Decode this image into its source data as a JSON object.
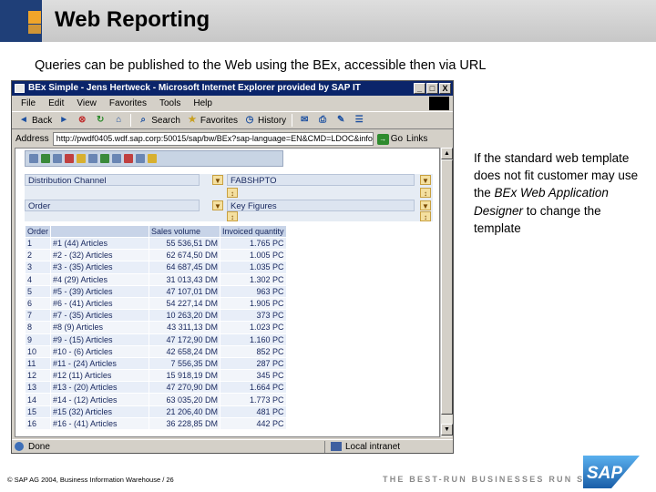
{
  "slide": {
    "title": "Web Reporting",
    "subtitle": "Queries can be published to the Web using the BEx, accessible then via URL",
    "side_text_1": "If the standard web template does not fit customer may use the ",
    "side_text_italic": "BEx Web Application Designer",
    "side_text_2": " to change the template",
    "footer_copyright": "© SAP AG 2004, Business Information Warehouse / 26",
    "footer_tagline": "THE BEST-RUN BUSINESSES RUN SAP",
    "logo_text": "SAP",
    "colors": {
      "header_accent": "#1f3f78",
      "orange": "#f0a52a",
      "sap_blue": "#1f6fc0"
    }
  },
  "browser": {
    "title": "BEx Simple - Jens Hertweck - Microsoft Internet Explorer provided by SAP IT",
    "window_buttons": [
      "_",
      "□",
      "X"
    ],
    "menu": [
      "File",
      "Edit",
      "View",
      "Favorites",
      "Tools",
      "Help"
    ],
    "toolbar": {
      "back": "Back",
      "search": "Search",
      "favorites": "Favorites",
      "history": "History"
    },
    "address_label": "Address",
    "address_value": "http://pwdf0405.wdf.sap.corp:50015/sap/bw/BEx?sap-language=EN&CMD=LDOC&infocube",
    "go_label": "Go",
    "links_label": "Links",
    "status_left": "Done",
    "status_right": "Local intranet"
  },
  "bex": {
    "nav": {
      "distribution_channel": "Distribution Channel",
      "fabshpto": "FABSHPTO",
      "order": "Order",
      "key_figures": "Key Figures"
    },
    "table": {
      "headers": [
        "Order",
        "",
        "Sales volume",
        "Invoiced quantity"
      ],
      "rows": [
        [
          "1",
          "#1  (44) Articles",
          "55 536,51 DM",
          "1.765 PC"
        ],
        [
          "2",
          "#2 - (32) Articles",
          "62 674,50 DM",
          "1.005 PC"
        ],
        [
          "3",
          "#3 - (35) Articles",
          "64 687,45 DM",
          "1.035 PC"
        ],
        [
          "4",
          "#4   (29) Articles",
          "31 013,43 DM",
          "1.302 PC"
        ],
        [
          "5",
          "#5 - (39) Articles",
          "47 107,01 DM",
          "963 PC"
        ],
        [
          "6",
          "#6 - (41) Articles",
          "54 227,14 DM",
          "1.905 PC"
        ],
        [
          "7",
          "#7 - (35) Articles",
          "10 263,20 DM",
          "373 PC"
        ],
        [
          "8",
          "#8   (9) Articles",
          "43 311,13 DM",
          "1.023 PC"
        ],
        [
          "9",
          "#9 - (15) Articles",
          "47 172,90 DM",
          "1.160 PC"
        ],
        [
          "10",
          "#10 - (6) Articles",
          "42 658,24 DM",
          "852 PC"
        ],
        [
          "11",
          "#11 - (24) Articles",
          "7 556,35 DM",
          "287 PC"
        ],
        [
          "12",
          "#12   (11) Articles",
          "15 918,19 DM",
          "345 PC"
        ],
        [
          "13",
          "#13 - (20) Articles",
          "47 270,90 DM",
          "1.664 PC"
        ],
        [
          "14",
          "#14 - (12) Articles",
          "63 035,20 DM",
          "1.773 PC"
        ],
        [
          "15",
          "#15   (32) Articles",
          "21 206,40 DM",
          "481 PC"
        ],
        [
          "16",
          "#16 - (41) Articles",
          "36 228,85 DM",
          "442 PC"
        ]
      ]
    }
  }
}
